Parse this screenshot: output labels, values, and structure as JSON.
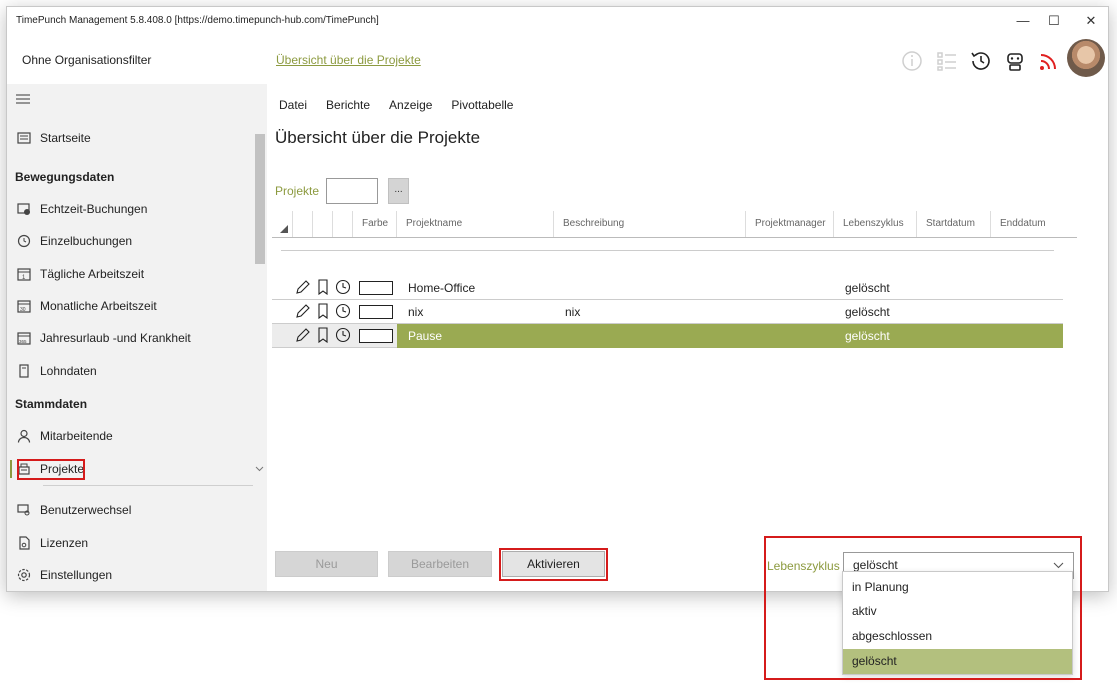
{
  "window": {
    "title": "TimePunch Management 5.8.408.0 [https://demo.timepunch-hub.com/TimePunch]",
    "controls": {
      "minimize": "—",
      "maximize": "☐",
      "close": "✕"
    }
  },
  "header": {
    "org_filter": "Ohne Organisationsfilter",
    "breadcrumb_link": "Übersicht über die Projekte"
  },
  "sidebar": {
    "items_top": [
      {
        "label": "Startseite",
        "icon": "home-icon"
      }
    ],
    "section_movement": "Bewegungsdaten",
    "items_movement": [
      {
        "label": "Echtzeit-Buchungen",
        "icon": "realtime-booking-icon"
      },
      {
        "label": "Einzelbuchungen",
        "icon": "clock-icon"
      },
      {
        "label": "Tägliche Arbeitszeit",
        "icon": "calendar-day-icon"
      },
      {
        "label": "Monatliche Arbeitszeit",
        "icon": "calendar-month-icon"
      },
      {
        "label": "Jahresurlaub -und Krankheit",
        "icon": "calendar-year-icon"
      },
      {
        "label": "Lohndaten",
        "icon": "document-icon"
      }
    ],
    "section_master": "Stammdaten",
    "items_master": [
      {
        "label": "Mitarbeitende",
        "icon": "person-icon"
      },
      {
        "label": "Projekte",
        "icon": "projects-icon"
      }
    ],
    "items_bottom": [
      {
        "label": "Benutzerwechsel",
        "icon": "user-switch-icon"
      },
      {
        "label": "Lizenzen",
        "icon": "license-icon"
      },
      {
        "label": "Einstellungen",
        "icon": "settings-icon"
      }
    ]
  },
  "menu": [
    "Datei",
    "Berichte",
    "Anzeige",
    "Pivottabelle"
  ],
  "page_title": "Übersicht über die Projekte",
  "filter": {
    "label": "Projekte",
    "value": "",
    "browse_label": "..."
  },
  "grid": {
    "columns": [
      "Farbe",
      "Projektname",
      "Beschreibung",
      "Projektmanager",
      "Lebenszyklus",
      "Startdatum",
      "Enddatum"
    ],
    "rows": [
      {
        "name": "Home-Office",
        "description": "",
        "manager": "",
        "lifecycle": "gelöscht",
        "start": "",
        "end": "",
        "selected": false
      },
      {
        "name": "nix",
        "description": "nix",
        "manager": "",
        "lifecycle": "gelöscht",
        "start": "",
        "end": "",
        "selected": false
      },
      {
        "name": "Pause",
        "description": "",
        "manager": "",
        "lifecycle": "gelöscht",
        "start": "",
        "end": "",
        "selected": true
      }
    ]
  },
  "buttons": {
    "new": "Neu",
    "edit": "Bearbeiten",
    "activate": "Aktivieren"
  },
  "lifecycle": {
    "label": "Lebenszyklus",
    "selected": "gelöscht",
    "options": [
      "in Planung",
      "aktiv",
      "abgeschlossen",
      "gelöscht"
    ]
  },
  "colors": {
    "accent": "#8c9a3f",
    "selected_row": "#9aaa52",
    "selected_option": "#b3c07e",
    "highlight_box": "#d51b1b"
  }
}
